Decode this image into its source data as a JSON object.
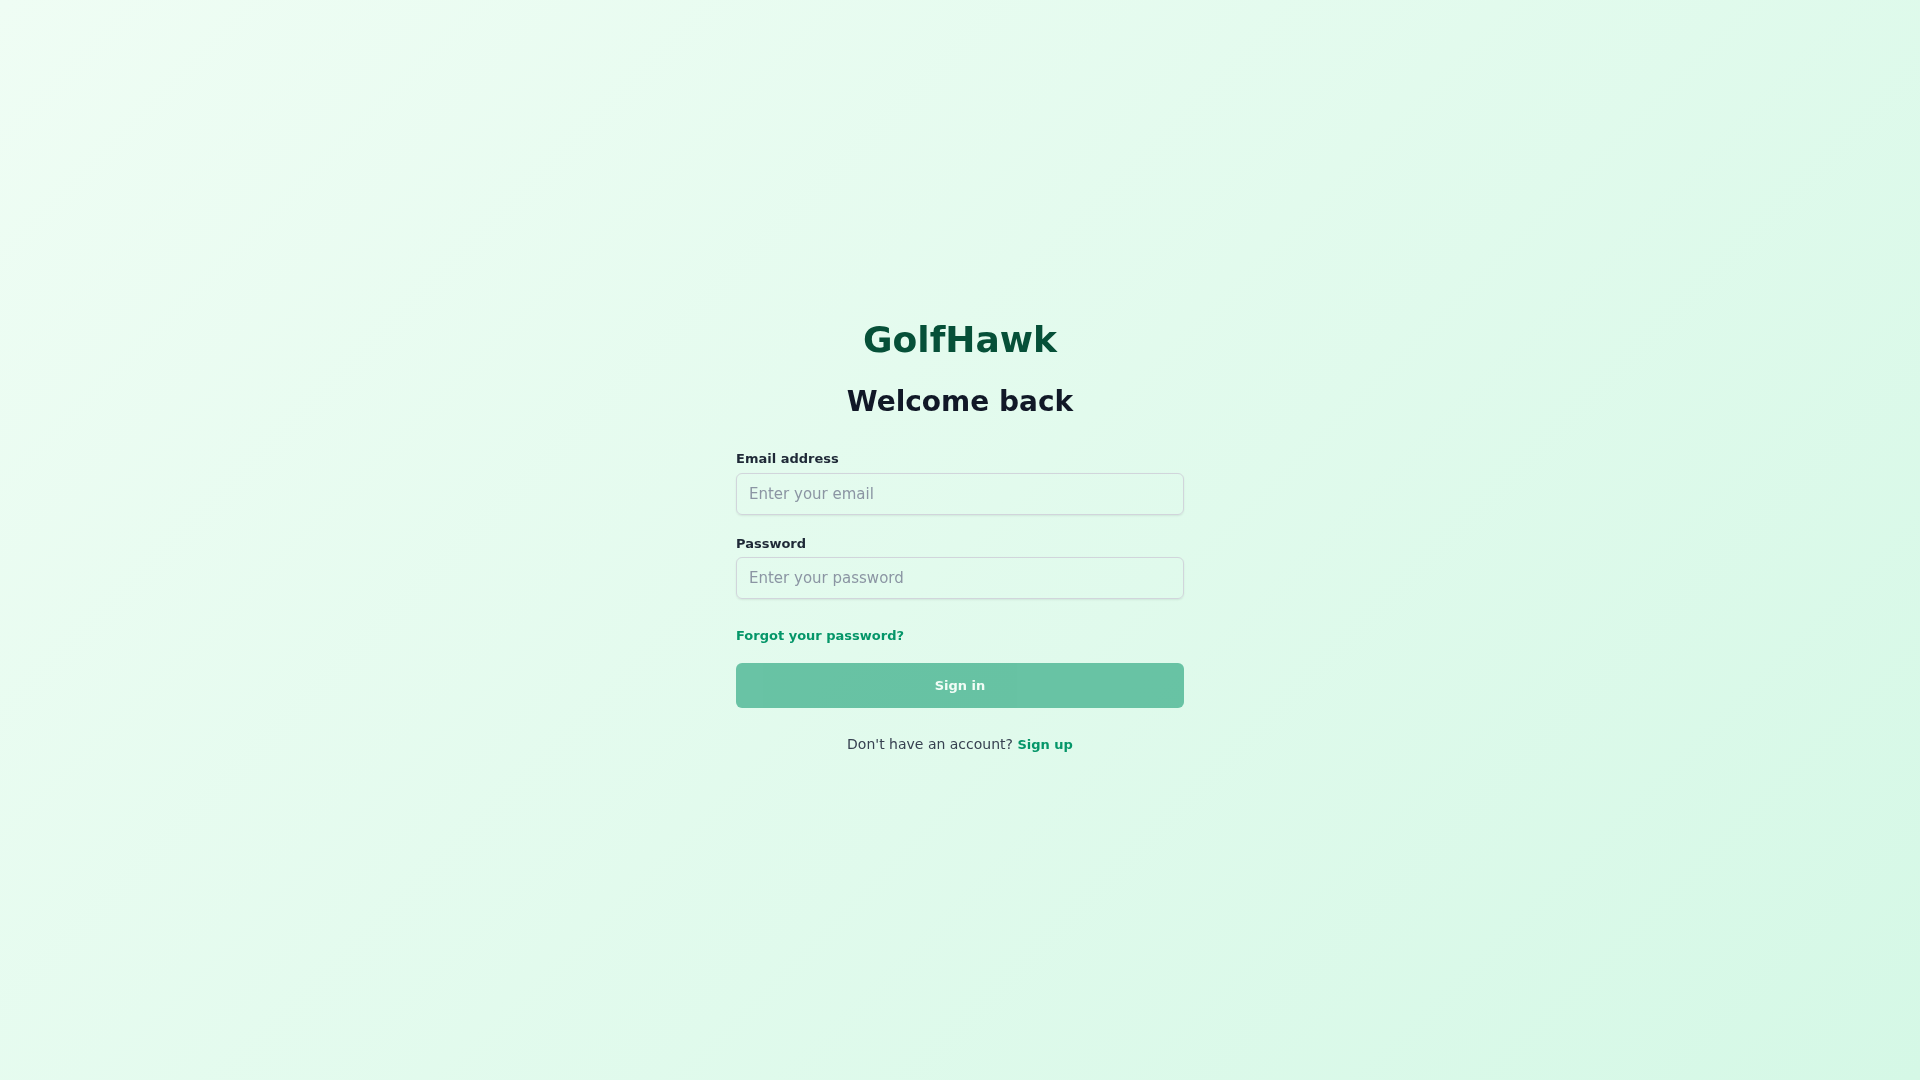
{
  "brand": "GolfHawk",
  "heading": "Welcome back",
  "fields": [
    {
      "label": "Email address",
      "placeholder": "Enter your email"
    },
    {
      "label": "Password",
      "placeholder": "Enter your password"
    }
  ],
  "forgot_link": "Forgot your password?",
  "submit_button": {
    "label": "Sign in",
    "disabled": true
  },
  "signup": {
    "text": "Don't have an account?",
    "link": "Sign up"
  }
}
